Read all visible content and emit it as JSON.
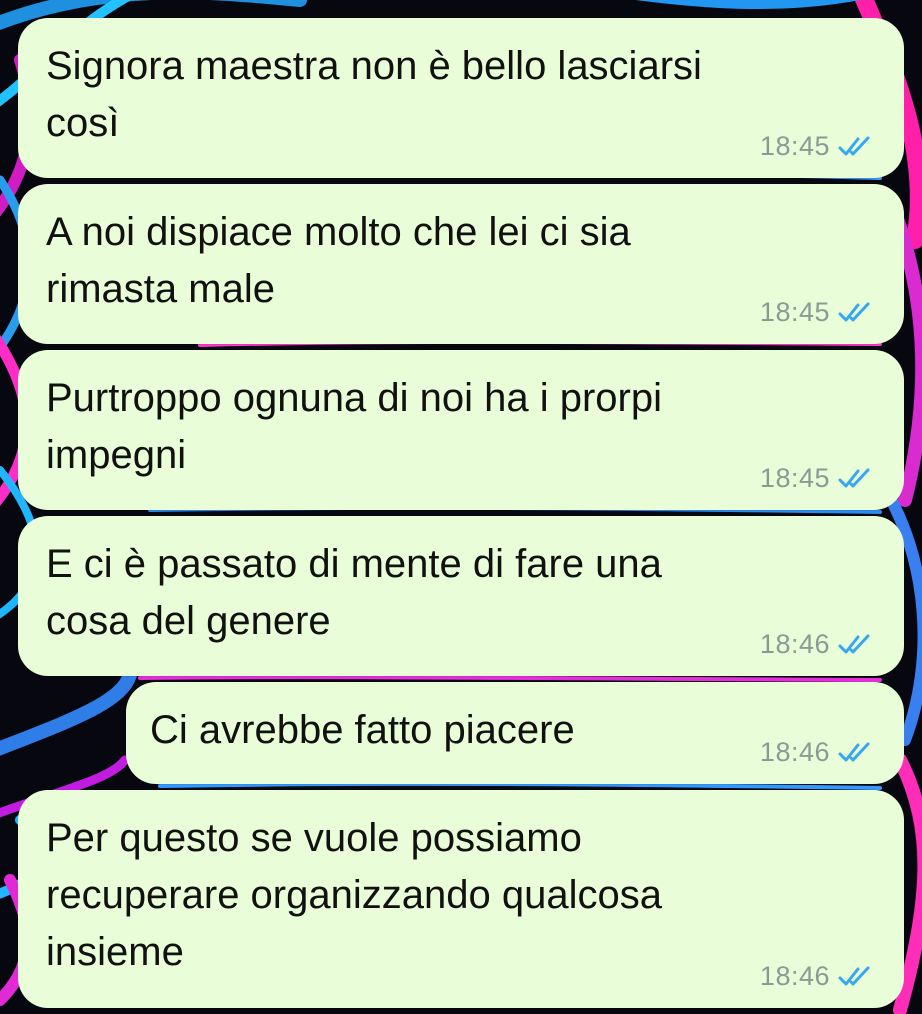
{
  "colors": {
    "bubble_background": "#e8fdd8",
    "text": "#111111",
    "time": "#8c9a93",
    "read_ticks": "#35a8f0"
  },
  "messages": [
    {
      "text": "Signora maestra non è bello lasciarsi\ncosì",
      "time": "18:45",
      "status_icon": "double-check-read-icon"
    },
    {
      "text": "A noi dispiace molto che lei ci sia\nrimasta male",
      "time": "18:45",
      "status_icon": "double-check-read-icon"
    },
    {
      "text": "Purtroppo ognuna di noi ha i prorpi\nimpegni",
      "time": "18:45",
      "status_icon": "double-check-read-icon"
    },
    {
      "text": "E ci è passato di mente di fare una\ncosa del genere",
      "time": "18:46",
      "status_icon": "double-check-read-icon"
    },
    {
      "text": "Ci avrebbe fatto piacere",
      "time": "18:46",
      "status_icon": "double-check-read-icon"
    },
    {
      "text": "Per questo se vuole possiamo\nrecuperare organizzando qualcosa\ninsieme",
      "time": "18:46",
      "status_icon": "double-check-read-icon"
    }
  ]
}
